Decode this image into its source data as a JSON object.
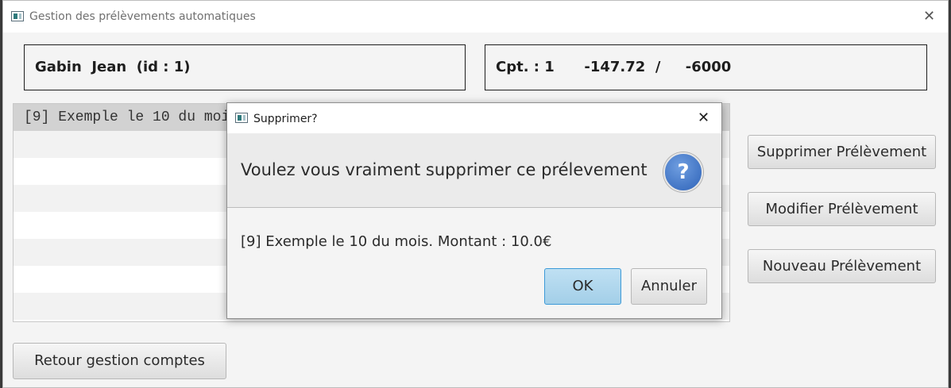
{
  "window": {
    "title": "Gestion des prélèvements automatiques"
  },
  "client_box": {
    "text": "Gabin  Jean  (id : 1)"
  },
  "account_box": {
    "text": "Cpt. : 1      -147.72  /     -6000"
  },
  "list": {
    "items": [
      "[9] Exemple le 10 du mois. Montant : 10.0€"
    ]
  },
  "buttons": {
    "delete": "Supprimer Prélèvement",
    "modify": "Modifier Prélèvement",
    "new": "Nouveau Prélèvement",
    "back": "Retour gestion comptes"
  },
  "dialog": {
    "title": "Supprimer?",
    "header": "Voulez vous vraiment supprimer ce prélevement",
    "content": "[9] Exemple le 10 du mois. Montant : 10.0€",
    "ok": "OK",
    "cancel": "Annuler",
    "icon": "question-icon"
  },
  "colors": {
    "ok_border": "#3d9ad8",
    "ok_fill": "#a3cfe8",
    "question_icon": "#2d62b8"
  }
}
